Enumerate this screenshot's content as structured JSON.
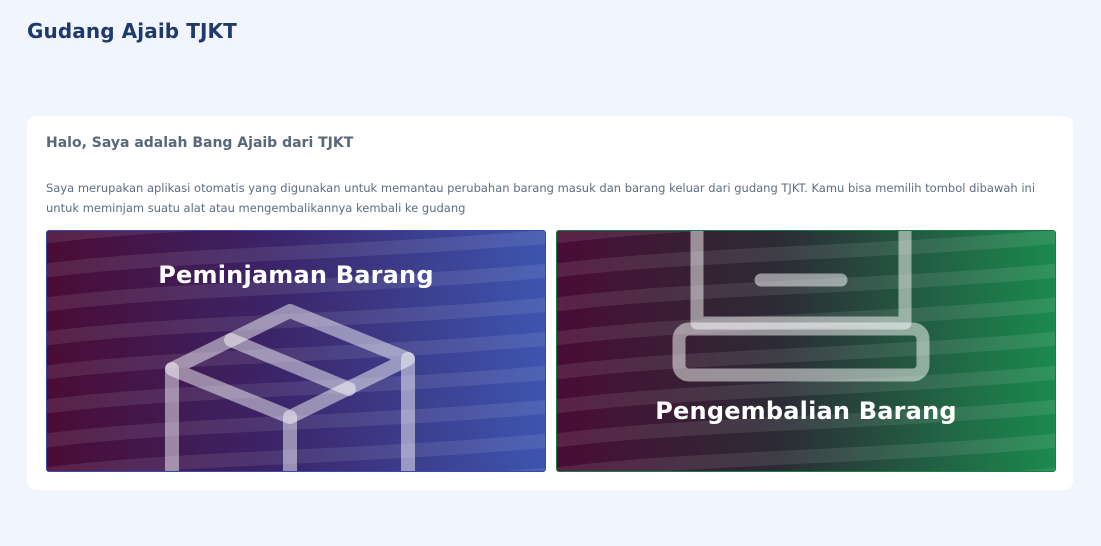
{
  "app": {
    "title": "Gudang Ajaib TJKT"
  },
  "intro": {
    "greeting": "Halo, Saya adalah Bang Ajaib dari TJKT",
    "description": "Saya merupakan aplikasi otomatis yang digunakan untuk memantau perubahan barang masuk dan barang keluar dari gudang TJKT. Kamu bisa memilih tombol dibawah ini untuk meminjam suatu alat atau mengembalikannya kembali ke gudang"
  },
  "actions": {
    "borrow": {
      "label": "Peminjaman Barang",
      "icon": "box-icon",
      "gradient": [
        "#4a0c35",
        "#3b2468",
        "#3d55b0"
      ]
    },
    "return": {
      "label": "Pengembalian Barang",
      "icon": "tray-icon",
      "gradient": [
        "#4a0c35",
        "#2b2c35",
        "#1b8a4e"
      ]
    }
  }
}
